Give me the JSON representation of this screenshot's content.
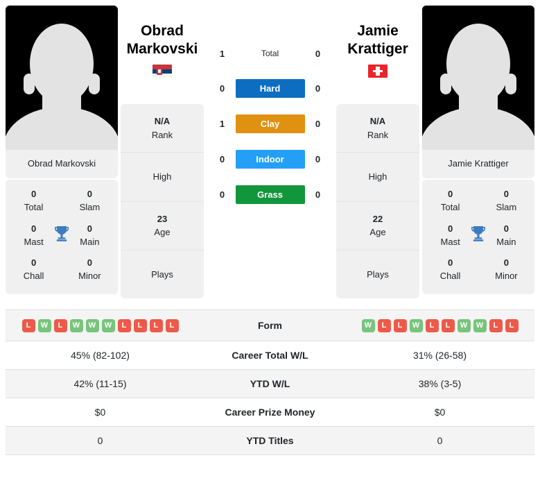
{
  "players": {
    "left": {
      "name_line1": "Obrad",
      "name_line2": "Markovski",
      "full_name": "Obrad Markovski",
      "flag": "serbia-flag",
      "rank_value": "N/A",
      "rank_label": "Rank",
      "high_label": "High",
      "age_value": "23",
      "age_label": "Age",
      "plays_label": "Plays",
      "titles": {
        "total_value": "0",
        "total_label": "Total",
        "slam_value": "0",
        "slam_label": "Slam",
        "mast_value": "0",
        "mast_label": "Mast",
        "main_value": "0",
        "main_label": "Main",
        "chall_value": "0",
        "chall_label": "Chall",
        "minor_value": "0",
        "minor_label": "Minor"
      },
      "form": [
        "L",
        "W",
        "L",
        "W",
        "W",
        "W",
        "L",
        "L",
        "L",
        "L"
      ],
      "career_total_wl": "45% (82-102)",
      "ytd_wl": "42% (11-15)",
      "career_prize_money": "$0",
      "ytd_titles": "0"
    },
    "right": {
      "name_line1": "Jamie",
      "name_line2": "Krattiger",
      "full_name": "Jamie Krattiger",
      "flag": "switzerland-flag",
      "rank_value": "N/A",
      "rank_label": "Rank",
      "high_label": "High",
      "age_value": "22",
      "age_label": "Age",
      "plays_label": "Plays",
      "titles": {
        "total_value": "0",
        "total_label": "Total",
        "slam_value": "0",
        "slam_label": "Slam",
        "mast_value": "0",
        "mast_label": "Mast",
        "main_value": "0",
        "main_label": "Main",
        "chall_value": "0",
        "chall_label": "Chall",
        "minor_value": "0",
        "minor_label": "Minor"
      },
      "form": [
        "W",
        "L",
        "L",
        "W",
        "L",
        "L",
        "W",
        "W",
        "L",
        "L"
      ],
      "career_total_wl": "31% (26-58)",
      "ytd_wl": "38% (3-5)",
      "career_prize_money": "$0",
      "ytd_titles": "0"
    }
  },
  "head_to_head": [
    {
      "key": "total",
      "label": "Total",
      "left": "1",
      "right": "0",
      "color": "transparent",
      "plain": true
    },
    {
      "key": "hard",
      "label": "Hard",
      "left": "0",
      "right": "0",
      "color": "#0d6ec1",
      "plain": false
    },
    {
      "key": "clay",
      "label": "Clay",
      "left": "1",
      "right": "0",
      "color": "#e09110",
      "plain": false
    },
    {
      "key": "indoor",
      "label": "Indoor",
      "left": "0",
      "right": "0",
      "color": "#23a0f5",
      "plain": false
    },
    {
      "key": "grass",
      "label": "Grass",
      "left": "0",
      "right": "0",
      "color": "#12963b",
      "plain": false
    }
  ],
  "table": {
    "rows": [
      {
        "label": "Form",
        "type": "form"
      },
      {
        "label": "Career Total W/L",
        "type": "text",
        "field": "career_total_wl"
      },
      {
        "label": "YTD W/L",
        "type": "text",
        "field": "ytd_wl"
      },
      {
        "label": "Career Prize Money",
        "type": "text",
        "field": "career_prize_money"
      },
      {
        "label": "YTD Titles",
        "type": "text",
        "field": "ytd_titles"
      }
    ]
  },
  "colors": {
    "win": "#78c47c",
    "loss": "#ed5a4a",
    "card_bg": "#f0f0f0",
    "trophy": "#3d7bbf"
  }
}
